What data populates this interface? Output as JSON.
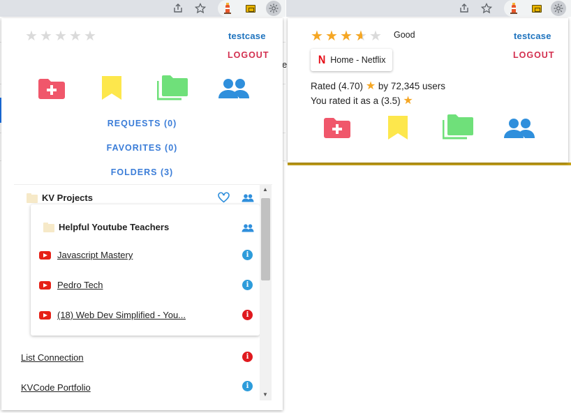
{
  "left_popup": {
    "stars": 5,
    "username": "testcase",
    "logout_label": "LOGOUT",
    "stats": {
      "requests": "REQUESTS (0)",
      "favorites": "FAVORITES (0)",
      "folders": "FOLDERS (3)"
    },
    "tree": {
      "root_folder": "KV Projects",
      "sub_folder": "Helpful Youtube Teachers",
      "sub_items": [
        {
          "label": "Javascript Mastery",
          "info": "blue"
        },
        {
          "label": "Pedro Tech",
          "info": "blue"
        },
        {
          "label": "(18) Web Dev Simplified - You...",
          "info": "red"
        }
      ],
      "items": [
        {
          "label": "List Connection",
          "info": "red"
        },
        {
          "label": "KVCode Portfolio",
          "info": "blue"
        }
      ]
    }
  },
  "right_popup": {
    "rating_value": 3.5,
    "rating_label": "Good",
    "username": "testcase",
    "logout_label": "LOGOUT",
    "site_chip": "Home - Netflix",
    "rated_prefix": "Rated (4.70)",
    "rated_suffix": "by 72,345 users",
    "you_rated": "You rated it as a (3.5)"
  },
  "background": {
    "letter": "e"
  },
  "colors": {
    "accent_blue": "#1e73be",
    "logout_red": "#d32f4f",
    "add_folder": "#f0576b",
    "bookmark": "#fde74c",
    "folders": "#6fe07a",
    "users": "#2f8fdc",
    "star": "#f5a623"
  },
  "icons": [
    "share-icon",
    "star-icon",
    "lighthouse-extension-icon",
    "folder-extension-icon",
    "settings-extension-icon",
    "add-folder-icon",
    "bookmark-icon",
    "folders-icon",
    "users-icon",
    "heart-icon",
    "folder-icon",
    "youtube-icon",
    "info-icon"
  ]
}
